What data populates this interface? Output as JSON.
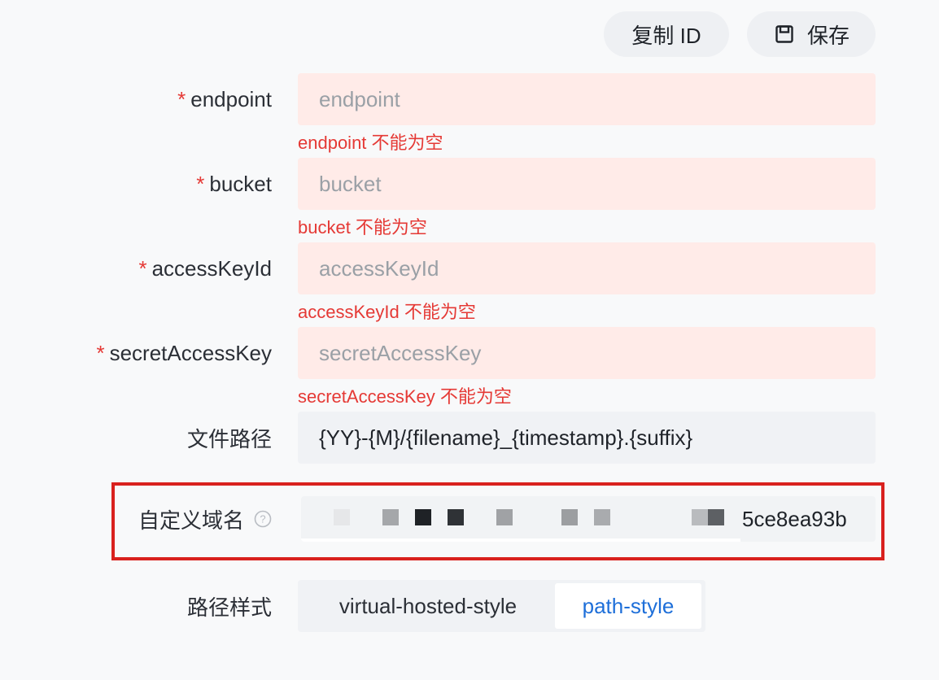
{
  "toolbar": {
    "copy_id_label": "复制 ID",
    "save_label": "保存",
    "save_icon": "floppy-disk-icon"
  },
  "fields": [
    {
      "label": "endpoint",
      "required": true,
      "placeholder": "endpoint",
      "error": "endpoint 不能为空"
    },
    {
      "label": "bucket",
      "required": true,
      "placeholder": "bucket",
      "error": "bucket 不能为空"
    },
    {
      "label": "accessKeyId",
      "required": true,
      "placeholder": "accessKeyId",
      "error": "accessKeyId 不能为空"
    },
    {
      "label": "secretAccessKey",
      "required": true,
      "placeholder": "secretAccessKey",
      "error": "secretAccessKey 不能为空"
    }
  ],
  "required_mark": "*",
  "file_path": {
    "label": "文件路径",
    "value": "{YY}-{M}/{filename}_{timestamp}.{suffix}"
  },
  "custom_domain": {
    "label": "自定义域名",
    "help_icon": "question-circle-icon",
    "value_visible": "5ce8ea93b"
  },
  "path_style": {
    "label": "路径样式",
    "options": [
      "virtual-hosted-style",
      "path-style"
    ],
    "selected": "path-style"
  },
  "colors": {
    "error": "#e53935",
    "error_bg": "#ffebe8",
    "accent": "#1e6fd9",
    "highlight": "#d9211e"
  }
}
